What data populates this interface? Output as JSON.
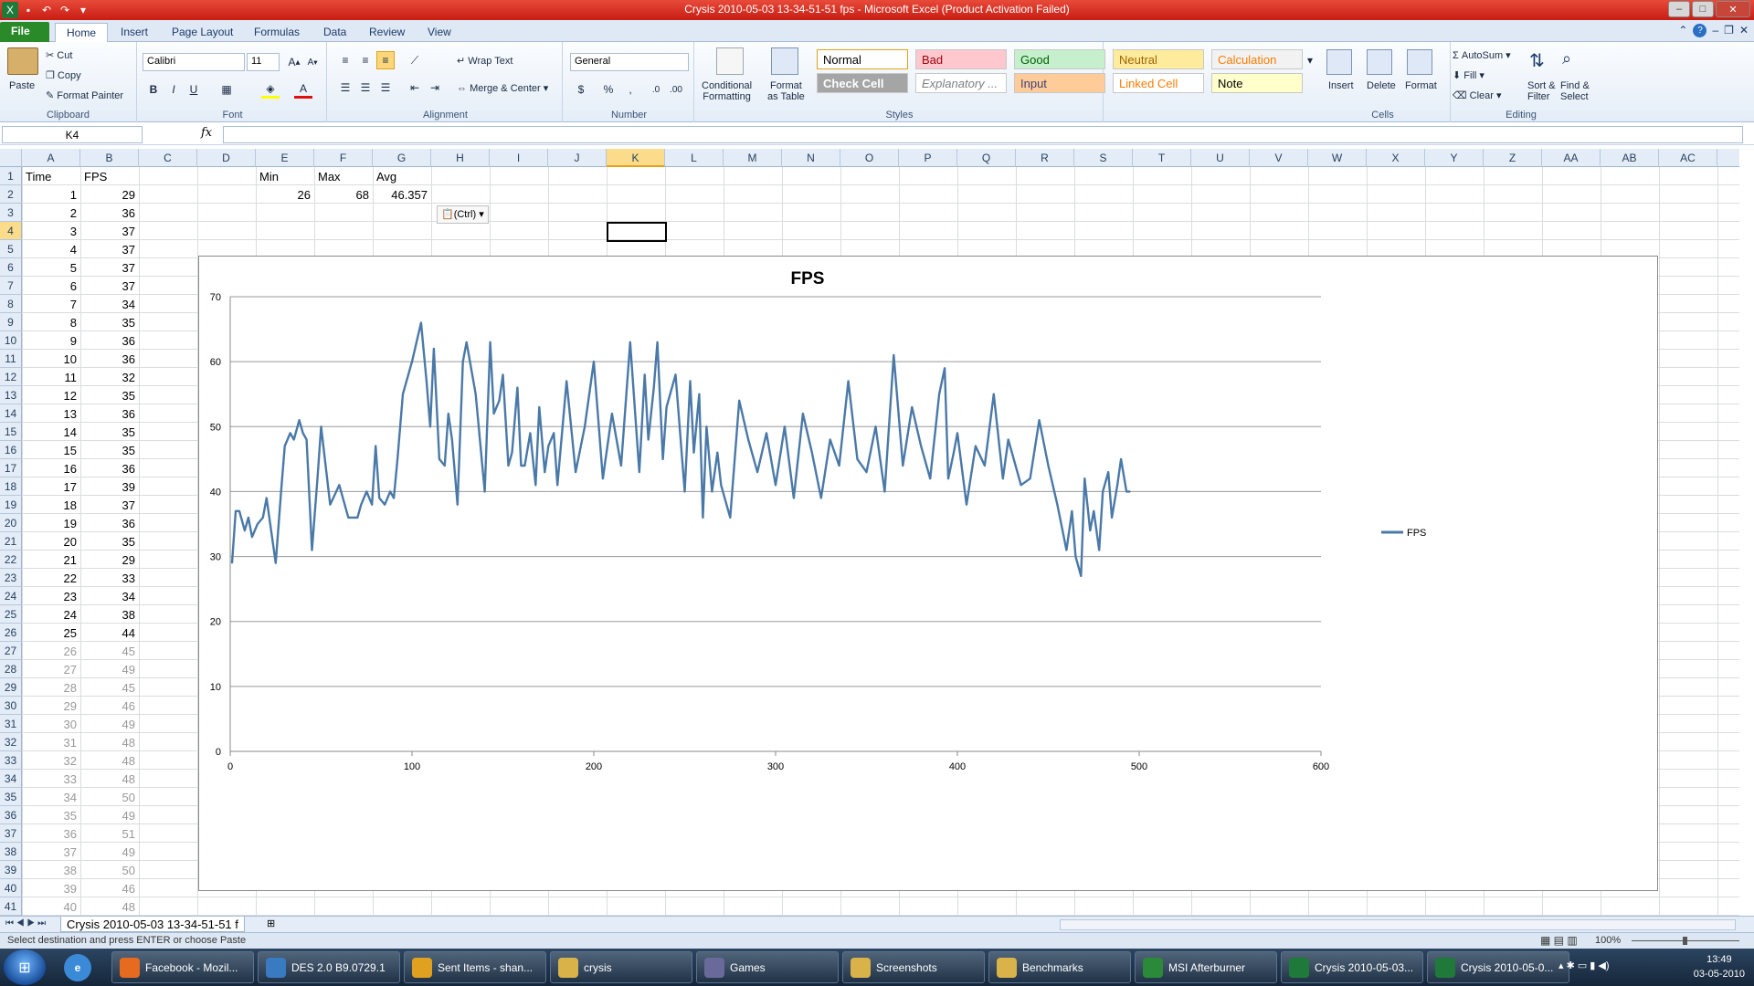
{
  "window": {
    "title": "Crysis 2010-05-03 13-34-51-51 fps  -  Microsoft Excel (Product Activation Failed)"
  },
  "tabs": [
    "File",
    "Home",
    "Insert",
    "Page Layout",
    "Formulas",
    "Data",
    "Review",
    "View"
  ],
  "ribbon": {
    "clipboard": {
      "paste": "Paste",
      "cut": "Cut",
      "copy": "Copy",
      "format_painter": "Format Painter",
      "group": "Clipboard"
    },
    "font": {
      "name": "Calibri",
      "size": "11",
      "group": "Font"
    },
    "alignment": {
      "wrap": "Wrap Text",
      "merge": "Merge & Center",
      "group": "Alignment"
    },
    "number": {
      "format": "General",
      "group": "Number"
    },
    "styles": {
      "cond": "Conditional\nFormatting",
      "table": "Format\nas Table",
      "cells": [
        {
          "label": "Normal",
          "bg": "#ffffff",
          "fg": "#000000"
        },
        {
          "label": "Bad",
          "bg": "#ffc7ce",
          "fg": "#9c0006"
        },
        {
          "label": "Good",
          "bg": "#c6efce",
          "fg": "#006100"
        },
        {
          "label": "Neutral",
          "bg": "#ffeb9c",
          "fg": "#9c6500"
        },
        {
          "label": "Calculation",
          "bg": "#f2f2f2",
          "fg": "#fa7d00"
        },
        {
          "label": "Check Cell",
          "bg": "#a5a5a5",
          "fg": "#ffffff"
        },
        {
          "label": "Explanatory ...",
          "bg": "#ffffff",
          "fg": "#7f7f7f"
        },
        {
          "label": "Input",
          "bg": "#ffcc99",
          "fg": "#3f3f76"
        },
        {
          "label": "Linked Cell",
          "bg": "#ffffff",
          "fg": "#fa7d00"
        },
        {
          "label": "Note",
          "bg": "#ffffcc",
          "fg": "#000000"
        }
      ],
      "group": "Styles"
    },
    "cells": {
      "insert": "Insert",
      "delete": "Delete",
      "format": "Format",
      "group": "Cells"
    },
    "editing": {
      "autosum": "AutoSum",
      "fill": "Fill",
      "clear": "Clear",
      "sort": "Sort &\nFilter",
      "find": "Find &\nSelect",
      "group": "Editing"
    }
  },
  "formula_bar": {
    "name_box": "K4",
    "fx": "fx",
    "formula": ""
  },
  "columns": [
    "A",
    "B",
    "C",
    "D",
    "E",
    "F",
    "G",
    "H",
    "I",
    "J",
    "K",
    "L",
    "M",
    "N",
    "O",
    "P",
    "Q",
    "R",
    "S",
    "T",
    "U",
    "V",
    "W",
    "X",
    "Y",
    "Z",
    "AA",
    "AB",
    "AC"
  ],
  "active_column": "K",
  "active_row": 4,
  "rows": [
    1,
    2,
    3,
    4,
    5,
    6,
    7,
    8,
    9,
    10,
    11,
    12,
    13,
    14,
    15,
    16,
    17,
    18,
    19,
    20,
    21,
    22,
    23,
    24,
    25,
    26,
    27,
    28,
    29,
    30,
    31,
    32,
    33,
    34,
    35,
    36,
    37,
    38,
    39,
    40,
    41
  ],
  "headers": {
    "time": "Time",
    "fps": "FPS",
    "min": "Min",
    "max": "Max",
    "avg": "Avg"
  },
  "summary": {
    "min": "26",
    "max": "68",
    "avg": "46.357"
  },
  "paste_options": "(Ctrl)",
  "table_rows": [
    [
      "1",
      "29"
    ],
    [
      "2",
      "36"
    ],
    [
      "3",
      "37"
    ],
    [
      "4",
      "37"
    ],
    [
      "5",
      "37"
    ],
    [
      "6",
      "37"
    ],
    [
      "7",
      "34"
    ],
    [
      "8",
      "35"
    ],
    [
      "9",
      "36"
    ],
    [
      "10",
      "36"
    ],
    [
      "11",
      "32"
    ],
    [
      "12",
      "35"
    ],
    [
      "13",
      "36"
    ],
    [
      "14",
      "35"
    ],
    [
      "15",
      "35"
    ],
    [
      "16",
      "36"
    ],
    [
      "17",
      "39"
    ],
    [
      "18",
      "37"
    ],
    [
      "19",
      "36"
    ],
    [
      "20",
      "35"
    ],
    [
      "21",
      "29"
    ],
    [
      "22",
      "33"
    ],
    [
      "23",
      "34"
    ],
    [
      "24",
      "38"
    ],
    [
      "25",
      "44"
    ],
    [
      "26",
      "45"
    ],
    [
      "27",
      "49"
    ],
    [
      "28",
      "45"
    ],
    [
      "29",
      "46"
    ],
    [
      "30",
      "49"
    ],
    [
      "31",
      "48"
    ],
    [
      "32",
      "48"
    ],
    [
      "33",
      "48"
    ],
    [
      "34",
      "50"
    ],
    [
      "35",
      "49"
    ],
    [
      "36",
      "51"
    ],
    [
      "37",
      "49"
    ],
    [
      "38",
      "50"
    ],
    [
      "39",
      "46"
    ],
    [
      "40",
      "48"
    ]
  ],
  "chart_data": {
    "type": "line",
    "title": "FPS",
    "xlabel": "",
    "ylabel": "",
    "xlim": [
      0,
      600
    ],
    "ylim": [
      0,
      70
    ],
    "x_ticks": [
      "0",
      "100",
      "200",
      "300",
      "400",
      "500",
      "600"
    ],
    "y_ticks": [
      "0",
      "10",
      "20",
      "30",
      "40",
      "50",
      "60",
      "70"
    ],
    "grid": true,
    "legend": "right",
    "series": [
      {
        "name": "FPS",
        "color": "#4a79a8",
        "x": [
          1,
          3,
          5,
          8,
          10,
          12,
          15,
          18,
          20,
          22,
          25,
          28,
          30,
          33,
          35,
          38,
          40,
          42,
          45,
          48,
          50,
          55,
          60,
          65,
          70,
          72,
          75,
          78,
          80,
          82,
          85,
          88,
          90,
          92,
          95,
          100,
          105,
          108,
          110,
          112,
          115,
          118,
          120,
          122,
          125,
          128,
          130,
          135,
          140,
          143,
          145,
          148,
          150,
          153,
          155,
          158,
          160,
          162,
          165,
          168,
          170,
          173,
          175,
          178,
          180,
          185,
          190,
          195,
          200,
          205,
          210,
          215,
          220,
          225,
          228,
          230,
          233,
          235,
          238,
          240,
          245,
          250,
          253,
          255,
          258,
          260,
          262,
          265,
          268,
          270,
          275,
          280,
          285,
          290,
          295,
          300,
          305,
          310,
          315,
          320,
          325,
          330,
          335,
          340,
          345,
          350,
          355,
          360,
          365,
          370,
          375,
          380,
          385,
          390,
          393,
          395,
          398,
          400,
          405,
          410,
          415,
          420,
          425,
          428,
          430,
          435,
          440,
          445,
          450,
          455,
          460,
          463,
          465,
          468,
          470,
          473,
          475,
          478,
          480,
          483,
          485,
          488,
          490,
          493,
          495
        ],
        "y": [
          29,
          37,
          37,
          34,
          36,
          33,
          35,
          36,
          39,
          35,
          29,
          40,
          47,
          49,
          48,
          51,
          49,
          48,
          31,
          42,
          50,
          38,
          41,
          36,
          36,
          38,
          40,
          38,
          47,
          39,
          38,
          40,
          39,
          45,
          55,
          60,
          66,
          57,
          50,
          62,
          45,
          44,
          52,
          48,
          38,
          60,
          63,
          55,
          40,
          63,
          52,
          54,
          58,
          44,
          46,
          56,
          44,
          44,
          49,
          41,
          53,
          43,
          47,
          49,
          41,
          57,
          43,
          50,
          60,
          42,
          52,
          44,
          63,
          43,
          58,
          48,
          56,
          63,
          45,
          53,
          58,
          40,
          57,
          46,
          55,
          36,
          50,
          40,
          46,
          41,
          36,
          54,
          48,
          43,
          49,
          41,
          50,
          39,
          52,
          46,
          39,
          48,
          44,
          57,
          45,
          43,
          50,
          40,
          61,
          44,
          53,
          47,
          42,
          55,
          59,
          42,
          46,
          49,
          38,
          47,
          44,
          55,
          42,
          48,
          46,
          41,
          42,
          51,
          44,
          38,
          31,
          37,
          30,
          27,
          42,
          34,
          37,
          31,
          40,
          43,
          36,
          41,
          45,
          40,
          40
        ]
      }
    ]
  },
  "sheet_tab": "Crysis 2010-05-03 13-34-51-51 f",
  "status": {
    "message": "Select destination and press ENTER or choose Paste",
    "zoom": "100%"
  },
  "taskbar": {
    "items": [
      {
        "label": "Facebook - Mozil...",
        "icon": "firefox-icon",
        "color": "#e66a1f"
      },
      {
        "label": "DES 2.0 B9.0729.1",
        "icon": "des-icon",
        "color": "#3a7ac0"
      },
      {
        "label": "Sent Items - shan...",
        "icon": "outlook-icon",
        "color": "#e0a020"
      },
      {
        "label": "crysis",
        "icon": "folder-icon",
        "color": "#d9b24a"
      },
      {
        "label": "Games",
        "icon": "games-icon",
        "color": "#6a6a9a"
      },
      {
        "label": "Screenshots",
        "icon": "folder-icon",
        "color": "#d9b24a"
      },
      {
        "label": "Benchmarks",
        "icon": "folder-icon",
        "color": "#d9b24a"
      },
      {
        "label": "MSI Afterburner",
        "icon": "afterburner-icon",
        "color": "#2a8a3a"
      },
      {
        "label": "Crysis 2010-05-03...",
        "icon": "excel-icon",
        "color": "#1f7a3a"
      },
      {
        "label": "Crysis 2010-05-0...",
        "icon": "excel-icon",
        "color": "#1f7a3a"
      }
    ],
    "time": "13:49",
    "date": "03-05-2010"
  }
}
